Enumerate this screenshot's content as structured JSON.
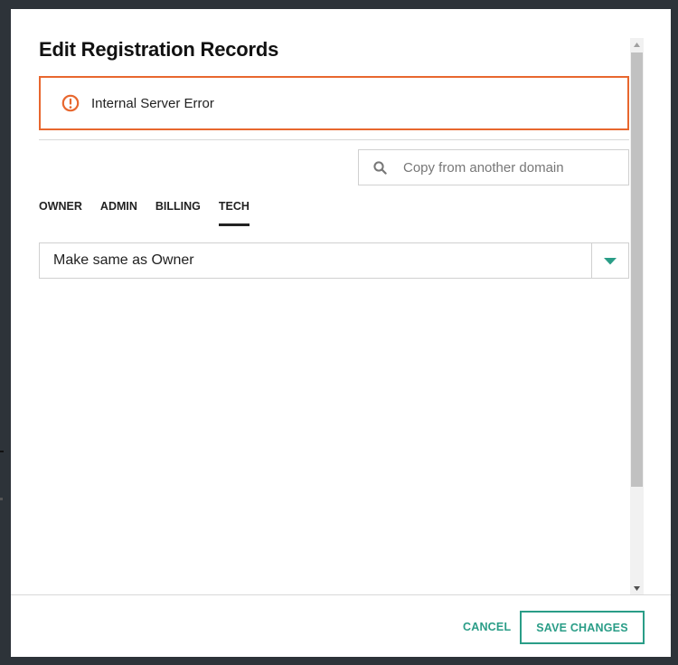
{
  "dialog": {
    "title": "Edit Registration Records"
  },
  "error": {
    "message": "Internal Server Error",
    "icon": "alert-circle-icon",
    "color": "#e8672e"
  },
  "search": {
    "placeholder": "Copy from another domain",
    "value": "",
    "icon": "search-icon"
  },
  "tabs": [
    {
      "label": "OWNER",
      "active": false
    },
    {
      "label": "ADMIN",
      "active": false
    },
    {
      "label": "BILLING",
      "active": false
    },
    {
      "label": "TECH",
      "active": true
    }
  ],
  "contact_select": {
    "selected": "Make same as Owner",
    "icon": "caret-down-icon"
  },
  "footer": {
    "cancel_label": "CANCEL",
    "save_label": "SAVE CHANGES"
  },
  "colors": {
    "accent": "#2a9d87",
    "error": "#e8672e",
    "backdrop": "#2d3339"
  }
}
